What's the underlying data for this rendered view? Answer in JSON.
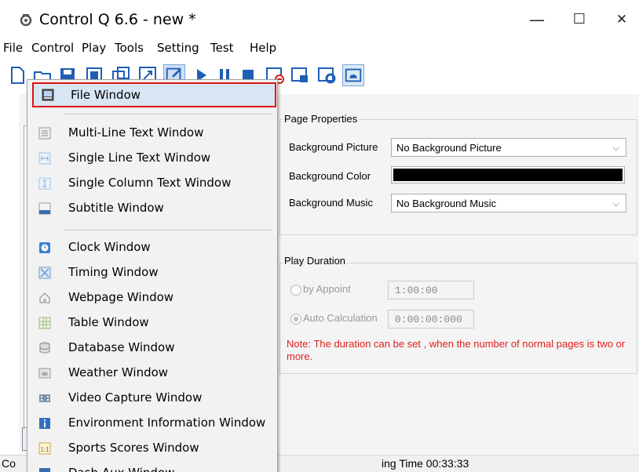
{
  "window": {
    "title": "Control Q 6.6 - new *",
    "minimize_glyph": "—",
    "maximize_glyph": "☐",
    "close_glyph": "✕",
    "icon": "app-gear-icon"
  },
  "menubar": {
    "items": [
      "File",
      "Control",
      "Play",
      "Tools",
      "Setting",
      "Test",
      "Help"
    ]
  },
  "toolbar": {
    "icons": [
      "new-icon",
      "open-icon",
      "save-icon",
      "page-icon",
      "copy-page-icon",
      "resize-icon",
      "edit-icon",
      "play-icon",
      "pause-icon",
      "stop-icon",
      "screen-off-icon",
      "lock-screen-icon",
      "settings-screen-icon",
      "cloud-icon"
    ]
  },
  "dropdown": {
    "items": [
      {
        "label": "File Window",
        "icon": "file-window-icon",
        "highlighted": true
      },
      {
        "label": "Multi-Line Text Window",
        "icon": "multi-line-text-icon"
      },
      {
        "label": "Single Line Text Window",
        "icon": "single-line-text-icon"
      },
      {
        "label": "Single Column Text Window",
        "icon": "single-column-text-icon"
      },
      {
        "label": "Subtitle Window",
        "icon": "subtitle-icon"
      },
      {
        "label": "Clock Window",
        "icon": "clock-icon"
      },
      {
        "label": "Timing Window",
        "icon": "timing-icon"
      },
      {
        "label": "Webpage Window",
        "icon": "webpage-icon"
      },
      {
        "label": "Table Window",
        "icon": "table-icon"
      },
      {
        "label": "Database Window",
        "icon": "database-icon"
      },
      {
        "label": "Weather Window",
        "icon": "weather-icon"
      },
      {
        "label": "Video Capture Window",
        "icon": "video-capture-icon"
      },
      {
        "label": "Environment Information Window",
        "icon": "environment-info-icon"
      },
      {
        "label": "Sports Scores Window",
        "icon": "sports-scores-icon"
      },
      {
        "label": "Dash Aux Window",
        "icon": "dash-aux-icon"
      }
    ]
  },
  "page_properties": {
    "title": "Page Properties",
    "background_picture_label": "Background Picture",
    "background_picture_value": "No Background Picture",
    "background_color_label": "Background Color",
    "background_color_value": "#000000",
    "background_music_label": "Background Music",
    "background_music_value": "No Background Music"
  },
  "play_duration": {
    "title": "Play Duration",
    "by_appoint_label": "by Appoint",
    "by_appoint_value": "1:00:00",
    "auto_calc_label": "Auto Calculation",
    "auto_calc_value": "0:00:00:000",
    "note": "Note: The duration can be set , when the number of normal pages is two or more."
  },
  "statusbar": {
    "left_text": "Co",
    "right_text": "ing Time 00:33:33"
  },
  "colors": {
    "highlight_border": "#e01010",
    "note_text": "#e0201c",
    "toolbar_blue": "#1f5fb5"
  }
}
